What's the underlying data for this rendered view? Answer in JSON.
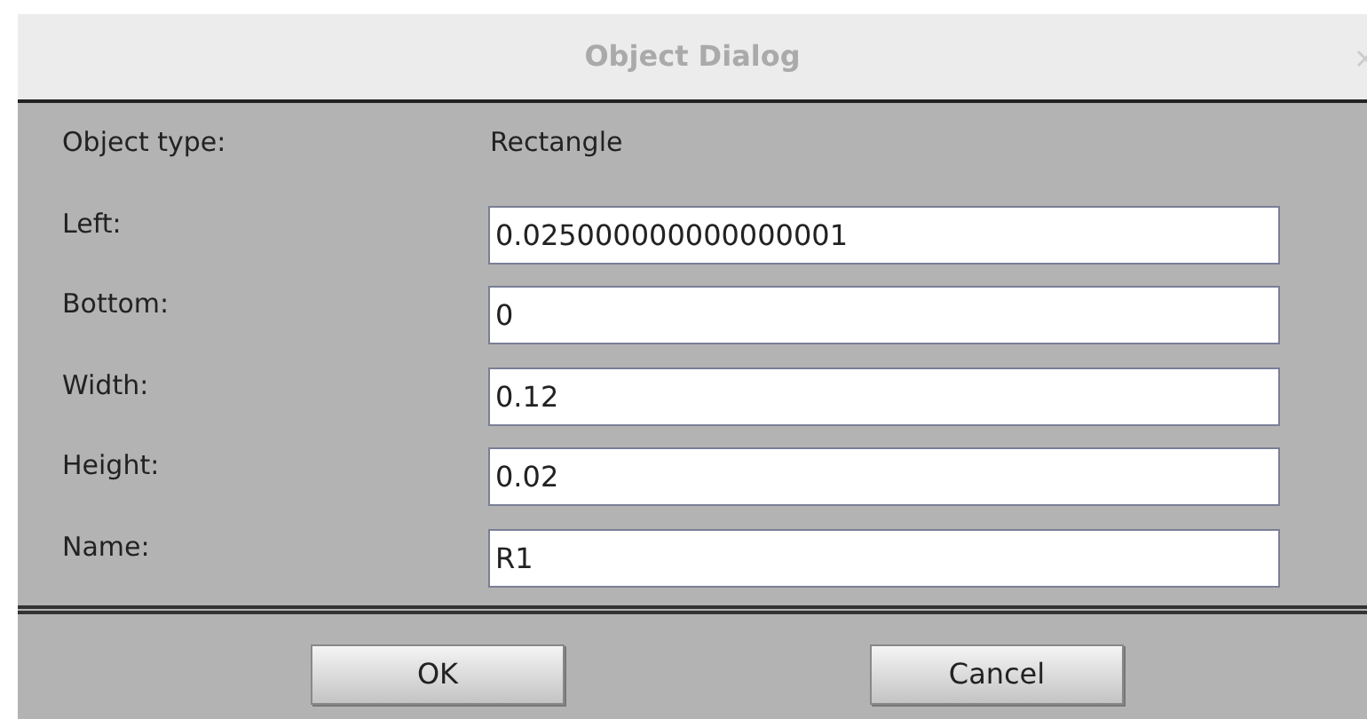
{
  "window": {
    "title": "Object Dialog"
  },
  "rows": [
    {
      "kind": "text",
      "label": "Object type:",
      "value": "Rectangle"
    },
    {
      "kind": "field",
      "label": "Left:",
      "value": "0.025000000000000001"
    },
    {
      "kind": "field",
      "label": "Bottom:",
      "value": "0"
    },
    {
      "kind": "field",
      "label": "Width:",
      "value": "0.12"
    },
    {
      "kind": "field",
      "label": "Height:",
      "value": "0.02"
    },
    {
      "kind": "field",
      "label": "Name:",
      "value": "R1"
    }
  ],
  "buttons": [
    "OK",
    "Cancel"
  ]
}
